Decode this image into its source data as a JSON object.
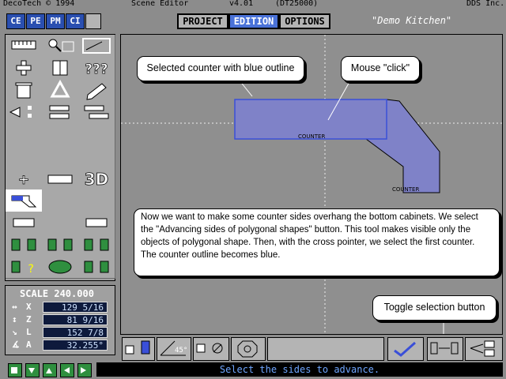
{
  "titlebar": {
    "company": "DecoTech © 1994",
    "title": "Scene Editor",
    "version": "v4.01",
    "build": "(DT25000)",
    "vendor": "DDS Inc."
  },
  "top_tabs": [
    "CE",
    "PE",
    "PM",
    "CI"
  ],
  "modes": {
    "project": "PROJECT",
    "edition": "EDITION",
    "options": "OPTIONS",
    "active": "EDITION"
  },
  "project_name": "\"Demo Kitchen\"",
  "canvas": {
    "counter1_label": "COUNTER",
    "counter2_label": "COUNTER",
    "selection_color": "#3a4fd8",
    "counter_fill": "#7f82c8"
  },
  "callouts": {
    "selected": "Selected counter with blue outline",
    "mouse": "Mouse \"click\"",
    "description": "Now we want to make some counter sides overhang the bottom cabinets. We select the \"Advancing sides of polygonal shapes\" button. This tool makes visible only the objects of polygonal shape. Then, with the cross pointer, we select the first counter. The counter outline becomes blue.",
    "toggle": "Toggle selection button"
  },
  "tools": {
    "three_d_label": "3D",
    "help_label": "???",
    "plus_label": "+"
  },
  "scale": {
    "title": "SCALE 240.000",
    "rows": [
      {
        "axis": "X",
        "value": "129  5/16"
      },
      {
        "axis": "Z",
        "value": "81  9/16"
      },
      {
        "axis": "L",
        "value": "152  7/8"
      },
      {
        "axis": "A",
        "value": "32.255°"
      }
    ]
  },
  "bottom_toolbar": {
    "angle_label": "45°"
  },
  "status": "Select the sides to advance."
}
